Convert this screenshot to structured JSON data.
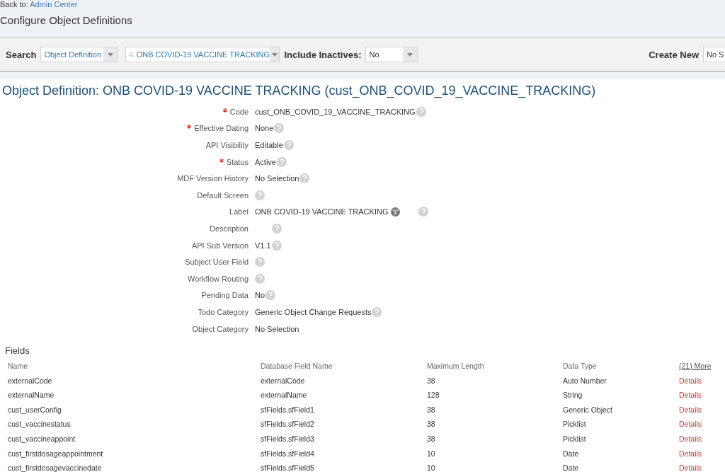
{
  "header": {
    "back_prefix": "Back to:",
    "back_link": "Admin Center",
    "title": "Configure Object Definitions"
  },
  "toolbar": {
    "search_label": "Search",
    "search_type": "Object Definition",
    "search_value": "ONB COVID-19 VACCINE TRACKING",
    "inactives_label": "Include Inactives:",
    "inactives_value": "No",
    "create_label": "Create New",
    "create_value": "No S"
  },
  "object_title": "Object Definition: ONB COVID-19 VACCINE TRACKING (cust_ONB_COVID_19_VACCINE_TRACKING)",
  "properties": [
    {
      "label": "Code",
      "required": true,
      "value": "cust_ONB_COVID_19_VACCINE_TRACKING",
      "help": true,
      "translatable": false
    },
    {
      "label": "Effective Dating",
      "required": true,
      "value": "None",
      "help": true,
      "translatable": false
    },
    {
      "label": "API Visibility",
      "required": false,
      "value": "Editable",
      "help": true,
      "translatable": false
    },
    {
      "label": "Status",
      "required": true,
      "value": "Active",
      "help": true,
      "translatable": false
    },
    {
      "label": "MDF Version History",
      "required": false,
      "value": "No Selection",
      "help": true,
      "translatable": false
    },
    {
      "label": "Default Screen",
      "required": false,
      "help": true,
      "translatable": false
    },
    {
      "label": "Label",
      "required": false,
      "value": "ONB COVID-19 VACCINE TRACKING",
      "help": true,
      "translatable": true
    },
    {
      "label": "Description",
      "required": false,
      "help": true,
      "translatable": false
    },
    {
      "label": "API Sub Version",
      "required": false,
      "value": "V1.1",
      "help": true,
      "translatable": false
    },
    {
      "label": "Subject User Field",
      "required": false,
      "help": true,
      "translatable": false
    },
    {
      "label": "Workflow Routing",
      "required": false,
      "help": true,
      "translatable": false
    },
    {
      "label": "Pending Data",
      "required": false,
      "value": "No",
      "help": true,
      "translatable": false
    },
    {
      "label": "Todo Category",
      "required": false,
      "value": "Generic Object Change Requests",
      "help": true,
      "translatable": false
    },
    {
      "label": "Object Category",
      "required": false,
      "value": "No Selection",
      "help": false,
      "translatable": false
    }
  ],
  "fields": {
    "title": "Fields",
    "columns": [
      "Name",
      "Database Field Name",
      "Maximum Length",
      "Data Type"
    ],
    "more_link": "(21) More",
    "rows": [
      {
        "name": "externalCode",
        "db_field": "externalCode",
        "max_length": "38",
        "data_type": "Auto Number",
        "action": "Details"
      },
      {
        "name": "externalName",
        "db_field": "externalName",
        "max_length": "128",
        "data_type": "String",
        "action": "Details"
      },
      {
        "name": "cust_userConfig",
        "db_field": "sfFields.sfField1",
        "max_length": "38",
        "data_type": "Generic Object",
        "action": "Details"
      },
      {
        "name": "cust_vaccinestatus",
        "db_field": "sfFields.sfField2",
        "max_length": "38",
        "data_type": "Picklist",
        "action": "Details"
      },
      {
        "name": "cust_vaccineappoint",
        "db_field": "sfFields.sfField3",
        "max_length": "38",
        "data_type": "Picklist",
        "action": "Details"
      },
      {
        "name": "cust_firstdosageappointment",
        "db_field": "sfFields.sfField4",
        "max_length": "10",
        "data_type": "Date",
        "action": "Details"
      },
      {
        "name": "cust_firstdosagevaccinedate",
        "db_field": "sfFields.sfField5",
        "max_length": "10",
        "data_type": "Date",
        "action": "Details"
      }
    ]
  }
}
